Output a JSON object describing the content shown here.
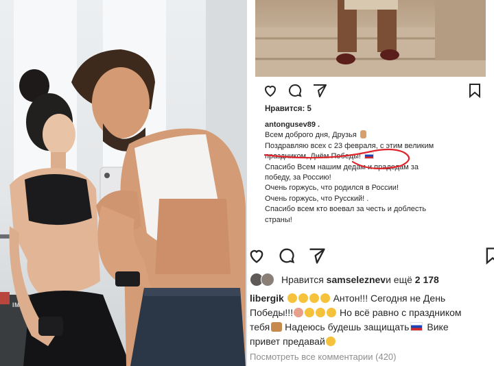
{
  "left_photo": {
    "gym_sign": "IMAGE"
  },
  "post1": {
    "likes_text": "Нравится: 5",
    "username": "antongusev89",
    "caption_lines": [
      "Всем доброго дня, Друзья",
      "Поздравляю всех с 23 февраля, с этим великим",
      "праздником, Днём Победы!",
      "Спасибо Всем нашим дедам и прадедам за",
      "победу, за Россию!",
      "Очень горжусь, что родился в  России!",
      "Очень горжусь, что Русский! .",
      "Спасибо всем кто воевал за честь и доблесть",
      "страны!"
    ],
    "username_suffix": " .",
    "icons": [
      "heart-icon",
      "comment-icon",
      "share-icon",
      "bookmark-icon"
    ]
  },
  "post2": {
    "liked_by_prefix": "Нравится ",
    "liked_by_user": "samseleznev",
    "liked_by_middle": " и ещё ",
    "liked_by_count": "2 178",
    "comment_user": "libergik",
    "comment_line1": " Антон!!! Сегодня не День",
    "comment_line2a": "Победы!!!",
    "comment_line2b": " Но всё равно с праздником",
    "comment_line3a": "тебя",
    "comment_line3b": " Надеюсь будешь защищать",
    "comment_line3c": " Вике",
    "comment_line4": "привет предавай",
    "view_all": "Посмотреть все комментарии (420)",
    "icons": [
      "heart-icon",
      "comment-icon",
      "share-icon",
      "bookmark-icon"
    ]
  },
  "colors": {
    "text": "#262626",
    "muted": "#8e8e8e",
    "annotation_red": "#e0242b",
    "emoji": "#f6c23b"
  }
}
